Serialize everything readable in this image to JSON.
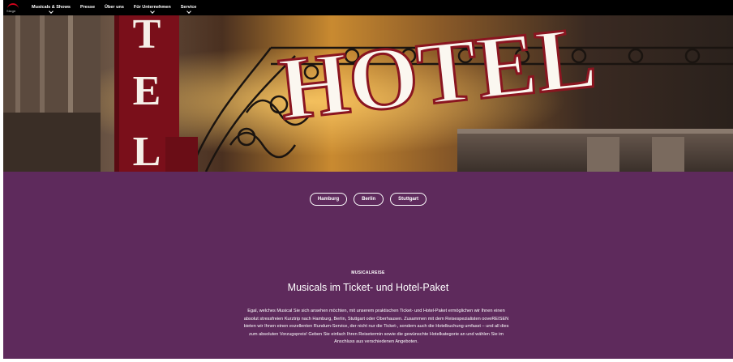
{
  "nav": {
    "logo_text": "Stage",
    "items": [
      {
        "label": "Musicals & Shows",
        "has_dropdown": true
      },
      {
        "label": "Presse",
        "has_dropdown": false
      },
      {
        "label": "Über uns",
        "has_dropdown": false
      },
      {
        "label": "Für Unternehmen",
        "has_dropdown": true
      },
      {
        "label": "Service",
        "has_dropdown": true
      }
    ]
  },
  "hero": {
    "sign_text_big": "HOTEL",
    "sign_text_vertical": "TEL"
  },
  "cities": [
    {
      "label": "Hamburg"
    },
    {
      "label": "Berlin"
    },
    {
      "label": "Stuttgart"
    }
  ],
  "content": {
    "kicker": "MUSICALREISE",
    "headline": "Musicals im Ticket- und Hotel-Paket",
    "body": "Egal, welches Musical Sie sich ansehen möchten, mit unserem praktischen Ticket- und Hotel-Paket ermöglichen wir Ihnen einen absolut stressfreien Kurztrip nach Hamburg, Berlin, Stuttgart oder Oberhausen. Zusammen mit dem Reisespezialisten ooveREISEN bieten wir Ihnen einen exzellenten Rundum-Service, der nicht nur die Ticket-, sondern auch die Hotelbuchung umfasst – und all dies zum absoluten Vorzugspreis! Geben Sie einfach Ihren Reisetermin sowie die gewünschte Hotelkategorie an und wählen Sie im Anschluss aus verschiedenen Angeboten."
  },
  "colors": {
    "nav_bg": "#000000",
    "purple_bg": "#5e2a5c",
    "logo_red": "#d0021b",
    "sign_red": "#7a0f1a"
  }
}
